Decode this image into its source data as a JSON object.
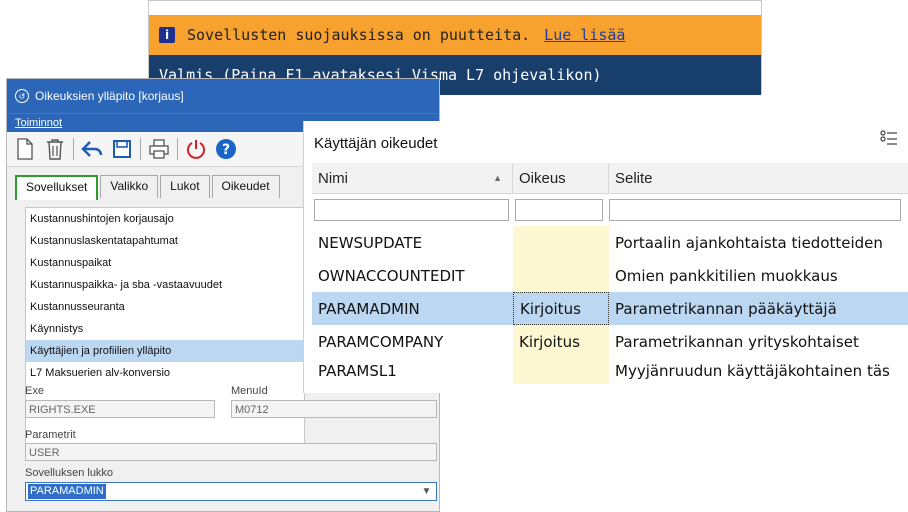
{
  "notification": {
    "message": "Sovellusten suojauksissa on puutteita.",
    "link": "Lue lisää",
    "status": "Valmis  (Paina F1 avataksesi Visma L7 ohjevalikon)"
  },
  "rights_window": {
    "title": "Oikeuksien ylläpito [korjaus]",
    "menu": "Toiminnot",
    "tabs": [
      "Sovellukset",
      "Valikko",
      "Lukot",
      "Oikeudet"
    ],
    "apps": [
      "Kustannushintojen korjausajo",
      "Kustannuslaskentatapahtumat",
      "Kustannuspaikat",
      "Kustannuspaikka- ja sba -vastaavuudet",
      "Kustannusseuranta",
      "Käynnistys",
      "Käyttäjien ja profiilien ylläpito",
      "L7 Maksuerien alv-konversio"
    ],
    "selected_app_index": 6,
    "exe_label": "Exe",
    "exe_value": "RIGHTS.EXE",
    "menuid_label": "MenuId",
    "menuid_value": "M0712",
    "param_label": "Parametrit",
    "param_value": "USER",
    "lock_label": "Sovelluksen lukko",
    "lock_value": "PARAMADMIN"
  },
  "user_rights": {
    "title": "Käyttäjän oikeudet",
    "columns": [
      "Nimi",
      "Oikeus",
      "Selite"
    ],
    "rows": [
      {
        "nimi": "NEWSUPDATE",
        "oikeus": "",
        "selite": "Portaalin ajankohtaista tiedotteiden"
      },
      {
        "nimi": "OWNACCOUNTEDIT",
        "oikeus": "",
        "selite": "Omien pankkitilien muokkaus"
      },
      {
        "nimi": "PARAMADMIN",
        "oikeus": "Kirjoitus",
        "selite": "Parametrikannan pääkäyttäjä"
      },
      {
        "nimi": "PARAMCOMPANY",
        "oikeus": "Kirjoitus",
        "selite": "Parametrikannan yrityskohtaiset"
      },
      {
        "nimi": "PARAMSL1",
        "oikeus": "",
        "selite": "Myyjänruudun käyttäjäkohtainen täs"
      }
    ],
    "selected_row_index": 2
  },
  "colors": {
    "notify_bar": "#f7a12e",
    "status_bar": "#183e6b",
    "title_bar": "#2b66b8",
    "selection": "#bcd7f2",
    "oikeus_cell": "#fdf7d2"
  }
}
